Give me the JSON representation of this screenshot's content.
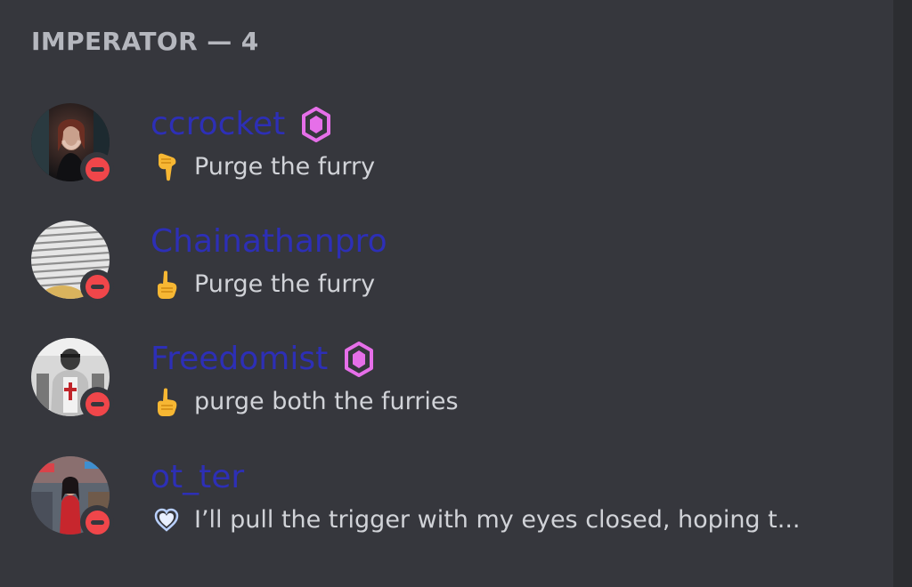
{
  "group": {
    "label": "IMPERATOR — 4"
  },
  "members": [
    {
      "name": "ccrocket",
      "has_badge": true,
      "status_emoji": "pointing-down-emoji",
      "status_text": "Purge the furry",
      "presence": "do-not-disturb"
    },
    {
      "name": "Chainathanpro",
      "has_badge": false,
      "status_emoji": "pointing-up-emoji",
      "status_text": "Purge the furry",
      "presence": "do-not-disturb"
    },
    {
      "name": "Freedomist",
      "has_badge": true,
      "status_emoji": "pointing-up-emoji",
      "status_text": "purge both the furries",
      "presence": "do-not-disturb"
    },
    {
      "name": "ot_ter",
      "has_badge": false,
      "status_emoji": "sparkling-heart-emoji",
      "status_text": "I’ll pull the trigger with my eyes closed, hoping t...",
      "presence": "do-not-disturb"
    }
  ],
  "colors": {
    "background": "#36373d",
    "username": "#2d2fb6",
    "dnd_status": "#f0464a",
    "badge": "#e66fe9",
    "header_text": "#b5b7be",
    "status_text": "#d1d3d8"
  }
}
